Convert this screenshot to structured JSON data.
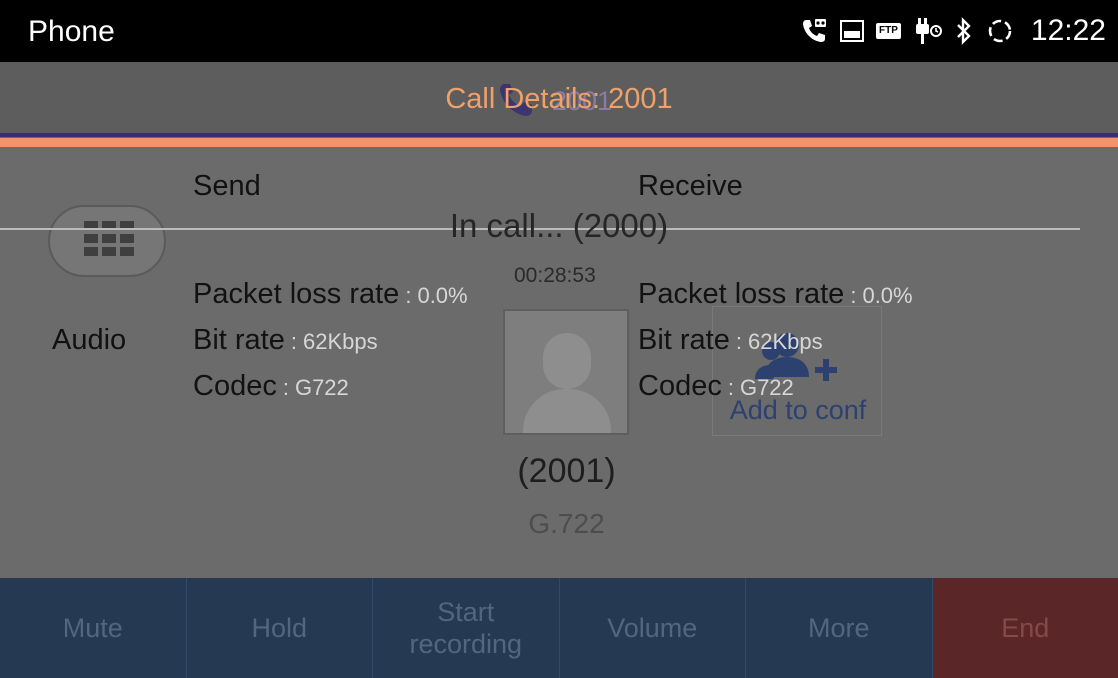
{
  "status_bar": {
    "app_title": "Phone",
    "time": "12:22",
    "icons": [
      "call-voicemail-icon",
      "image-icon",
      "ftp-icon",
      "usb-debug-icon",
      "bluetooth-icon",
      "sync-icon"
    ],
    "ftp_text": "FTP"
  },
  "call_screen": {
    "header_number": "2001",
    "status_text": "In call... (2000)",
    "timer": "00:28:53",
    "caller_number": "(2001)",
    "codec": "G.722",
    "add_to_conf_label": "Add to conf"
  },
  "call_details": {
    "title": "Call Details: 2001",
    "send_header": "Send",
    "receive_header": "Receive",
    "row_label": "Audio",
    "send": [
      {
        "label": "Packet loss rate",
        "value": "0.0%"
      },
      {
        "label": "Bit rate",
        "value": "62Kbps"
      },
      {
        "label": "Codec",
        "value": "G722"
      }
    ],
    "receive": [
      {
        "label": "Packet loss rate",
        "value": "0.0%"
      },
      {
        "label": "Bit rate",
        "value": "62Kbps"
      },
      {
        "label": "Codec",
        "value": "G722"
      }
    ],
    "separator": ":"
  },
  "actions": {
    "mute": "Mute",
    "hold": "Hold",
    "start_recording_line1": "Start",
    "start_recording_line2": "recording",
    "volume": "Volume",
    "more": "More",
    "end": "End"
  },
  "colors": {
    "accent_orange": "#f0956b",
    "action_bar": "#253a52",
    "end_button": "#5b2627",
    "header_purple": "#3a2f6e"
  }
}
